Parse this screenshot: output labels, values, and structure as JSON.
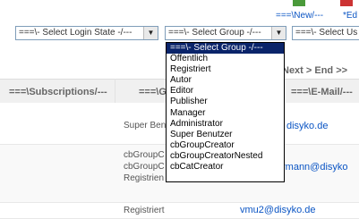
{
  "toolbar": {
    "new_label": "===\\New/---",
    "edit_label": "*Ed"
  },
  "filters": {
    "login_state": "===\\- Select Login State -/---",
    "group": "===\\- Select Group -/---",
    "user": "===\\- Select Us"
  },
  "pager": {
    "label": "Next > End >>"
  },
  "table": {
    "headers": {
      "subscriptions": "===\\Subscriptions/---",
      "group": "===\\G",
      "email": "===\\E-Mail/---"
    },
    "rows": [
      {
        "group": "Super Ben",
        "email": "disyko.de"
      },
      {
        "group_lines": [
          "cbGroupC",
          "cbGroupC",
          "Registrien"
        ],
        "email": "rmann@disyko"
      },
      {
        "group": "Registriert",
        "email": "vmu2@disyko.de"
      }
    ]
  },
  "dropdown": {
    "options": [
      "===\\- Select Group -/---",
      "Öffentlich",
      "Registriert",
      "Autor",
      "Editor",
      "Publisher",
      "Manager",
      "Administrator",
      "Super Benutzer",
      "cbGroupCreator",
      "cbGroupCreatorNested",
      "cbCatCreator"
    ],
    "selected_index": 0
  },
  "colors": {
    "link": "#0b55c4",
    "selection": "#0a246a"
  }
}
